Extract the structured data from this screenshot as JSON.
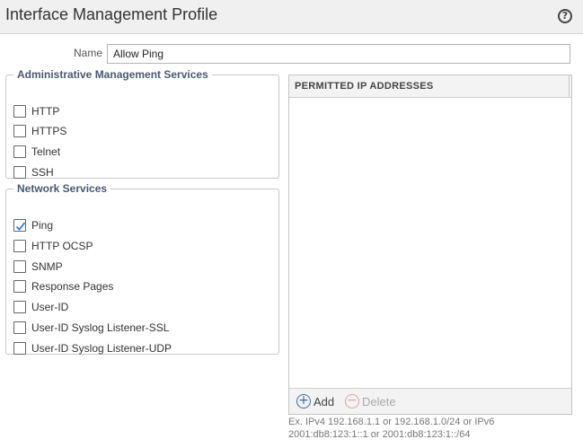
{
  "window": {
    "title": "Interface Management Profile",
    "help_icon": "?"
  },
  "name_field": {
    "label": "Name",
    "value": "Allow Ping"
  },
  "admin_services": {
    "legend": "Administrative Management Services",
    "items": [
      {
        "label": "HTTP",
        "checked": false
      },
      {
        "label": "HTTPS",
        "checked": false
      },
      {
        "label": "Telnet",
        "checked": false
      },
      {
        "label": "SSH",
        "checked": false
      }
    ]
  },
  "network_services": {
    "legend": "Network Services",
    "items": [
      {
        "label": "Ping",
        "checked": true
      },
      {
        "label": "HTTP OCSP",
        "checked": false
      },
      {
        "label": "SNMP",
        "checked": false
      },
      {
        "label": "Response Pages",
        "checked": false
      },
      {
        "label": "User-ID",
        "checked": false
      },
      {
        "label": "User-ID Syslog Listener-SSL",
        "checked": false
      },
      {
        "label": "User-ID Syslog Listener-UDP",
        "checked": false
      }
    ]
  },
  "permitted_ip": {
    "column_header": "PERMITTED IP ADDRESSES",
    "add_label": "Add",
    "delete_label": "Delete",
    "hint_line1": "Ex. IPv4 192.168.1.1 or 192.168.1.0/24 or IPv6",
    "hint_line2": "2001:db8:123:1::1 or 2001:db8:123:1::/64"
  },
  "colors": {
    "accent": "#2a7fd4",
    "legend_text": "#4a5a70",
    "header_bg": "#f0f0f0"
  }
}
